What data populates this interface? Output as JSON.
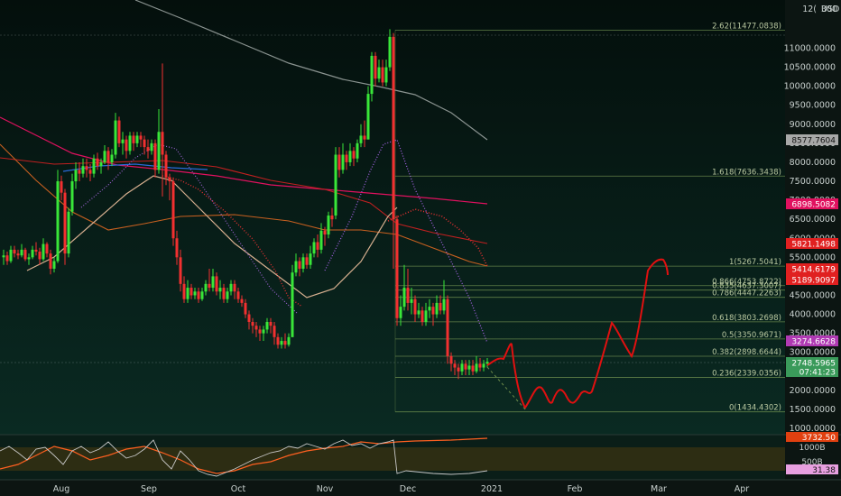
{
  "header": {
    "currency": "USD",
    "menu": "300"
  },
  "price_axis": [
    "11000.0000",
    "10500.0000",
    "10000.0000",
    "9500.0000",
    "9000.0000",
    "8500.0000",
    "8000.0000",
    "7500.0000",
    "7000.0000",
    "6500.0000",
    "6000.0000",
    "5500.0000",
    "5000.0000",
    "4500.0000",
    "4000.0000",
    "3500.0000",
    "3000.0000",
    "2500.0000",
    "2000.0000",
    "1500.0000",
    "1000.0000"
  ],
  "time_axis": [
    "Aug",
    "Sep",
    "Oct",
    "Nov",
    "Dec",
    "2021",
    "Feb",
    "Mar",
    "Apr"
  ],
  "fib_levels": [
    {
      "ratio": "2.62",
      "value": "11477.0838"
    },
    {
      "ratio": "1.618",
      "value": "7636.3438"
    },
    {
      "ratio": "1",
      "value": "5267.5041"
    },
    {
      "ratio": "0.866",
      "value": "4753.8722"
    },
    {
      "ratio": "0.835",
      "value": "4637.3007"
    },
    {
      "ratio": "0.786",
      "value": "4447.2263"
    },
    {
      "ratio": "0.618",
      "value": "3803.2698"
    },
    {
      "ratio": "0.5",
      "value": "3350.9671"
    },
    {
      "ratio": "0.382",
      "value": "2898.6644"
    },
    {
      "ratio": "0.236",
      "value": "2339.0356"
    },
    {
      "ratio": "0",
      "value": "1434.4302"
    }
  ],
  "price_tags": [
    {
      "text": "8577.7604",
      "bg": "#a8a8a8",
      "fg": "#111111"
    },
    {
      "text": "6898.5082",
      "bg": "#e0115f",
      "fg": "#ffffff"
    },
    {
      "text": "5821.1498",
      "bg": "#e02020",
      "fg": "#ffffff"
    },
    {
      "text": "5414.6179",
      "bg": "#e02020",
      "fg": "#ffffff"
    },
    {
      "text": "5189.9097",
      "bg": "#e02020",
      "fg": "#ffffff"
    },
    {
      "text": "3274.6628",
      "bg": "#b03ab3",
      "fg": "#ffffff"
    },
    {
      "text": "2748.5965",
      "bg": "#3a9a5a",
      "fg": "#ffffff"
    },
    {
      "text": "07:41:23",
      "bg": "#3a9a5a",
      "fg": "#ffffff"
    }
  ],
  "indicator": {
    "upper_tag": "3732.50",
    "scale_1": "1000B",
    "scale_2": "500B",
    "lower_tag": "31.38"
  }
}
